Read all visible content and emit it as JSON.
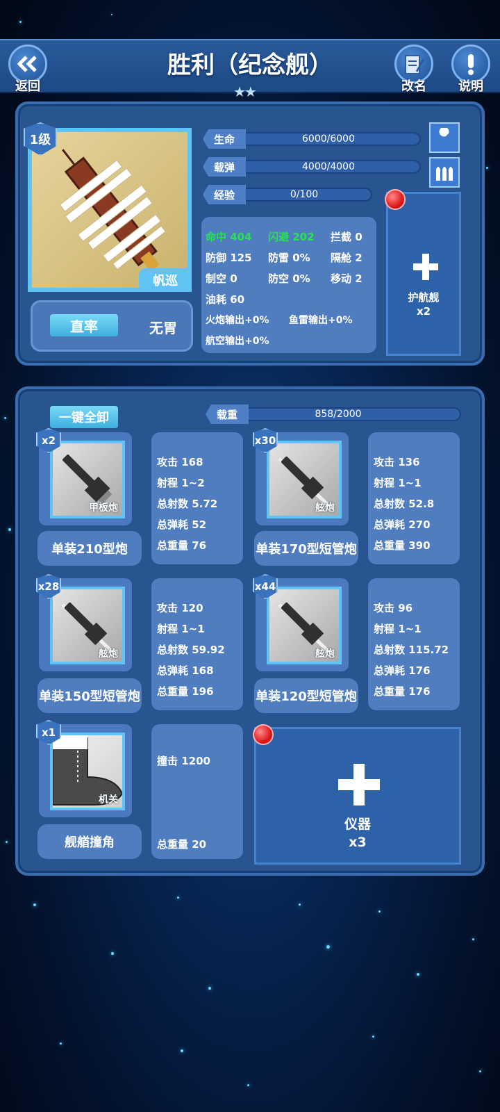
{
  "header": {
    "back_label": "返回",
    "title": "胜利（纪念舰）",
    "rating_stars": "★★",
    "rename_label": "改名",
    "help_label": "说明"
  },
  "ship": {
    "level": "1级",
    "class_tag": "帆巡",
    "mode_button": "直率",
    "mode_value": "无胃",
    "bars": [
      {
        "label": "生命",
        "value": "6000/6000",
        "fill": 1.0
      },
      {
        "label": "载弹",
        "value": "4000/4000",
        "fill": 1.0
      },
      {
        "label": "经验",
        "value": "0/100",
        "fill": 0.0
      }
    ],
    "stats": {
      "hit": "命中 404",
      "evade": "闪避 202",
      "intercept": "拦截 0",
      "defense": "防御 125",
      "torp_def": "防雷 0%",
      "bulkhead": "隔舱 2",
      "air_control": "制空 0",
      "aa": "防空 0%",
      "move": "移动 2",
      "fuel": "油耗 60",
      "gun_out": "火炮输出+0%",
      "torp_out": "鱼雷输出+0%",
      "air_out": "航空输出+0%"
    },
    "escort": {
      "label": "护航舰",
      "count": "x2"
    }
  },
  "equipment": {
    "unload_all": "一键全卸",
    "load": {
      "label": "载重",
      "value": "858/2000",
      "fill": 0.429
    },
    "items": [
      {
        "count": "x2",
        "tag": "甲板炮",
        "name": "单装210型炮",
        "lines": [
          "攻击 168",
          "射程 1~2",
          "总射数 5.72",
          "总弹耗 52",
          "总重量 76"
        ]
      },
      {
        "count": "x30",
        "tag": "舷炮",
        "name": "单装170型短管炮",
        "lines": [
          "攻击 136",
          "射程 1~1",
          "总射数 52.8",
          "总弹耗 270",
          "总重量 390"
        ]
      },
      {
        "count": "x28",
        "tag": "舷炮",
        "name": "单装150型短管炮",
        "lines": [
          "攻击 120",
          "射程 1~1",
          "总射数 59.92",
          "总弹耗 168",
          "总重量 196"
        ]
      },
      {
        "count": "x44",
        "tag": "舷炮",
        "name": "单装120型短管炮",
        "lines": [
          "攻击 96",
          "射程 1~1",
          "总射数 115.72",
          "总弹耗 176",
          "总重量 176"
        ]
      },
      {
        "count": "x1",
        "tag": "机关",
        "name": "舰艏撞角",
        "lines": [
          "撞击 1200",
          "",
          "",
          "",
          "总重量 20"
        ]
      }
    ],
    "instrument": {
      "label": "仪器",
      "count": "x3"
    }
  }
}
